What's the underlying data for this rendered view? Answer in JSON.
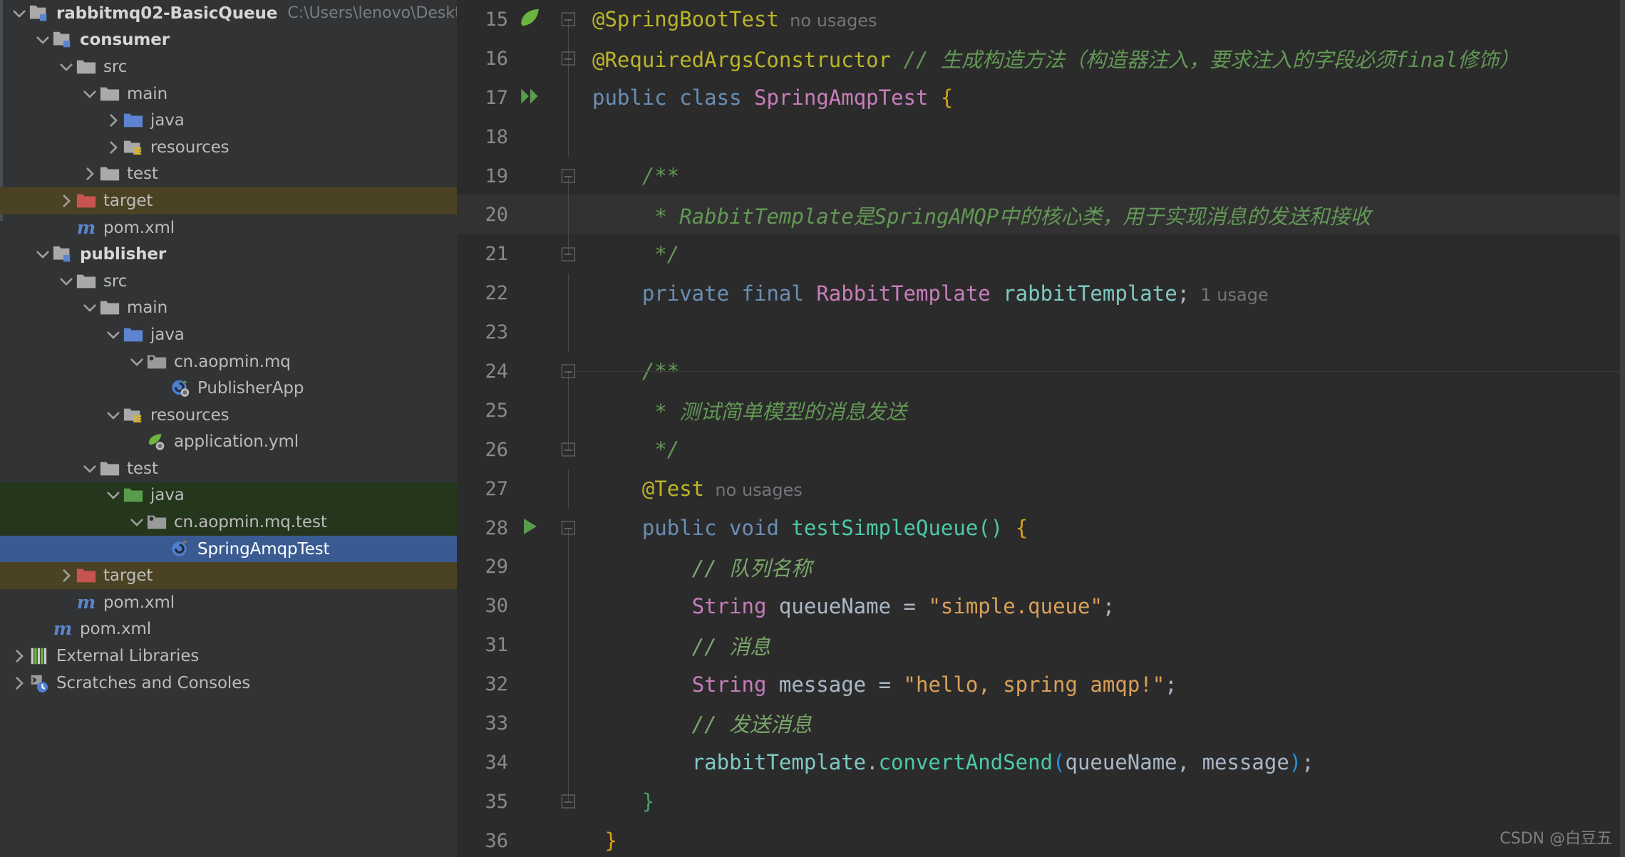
{
  "window": {
    "ide": "IntelliJ IDEA",
    "theme": "Darcula",
    "accent_selected": "#3a5b92",
    "accent_testsrc": "#24361c",
    "accent_excluded": "#4a4222"
  },
  "project_tree": {
    "panel_name": "Project",
    "items": [
      {
        "label": "rabbitmq02-BasicQueue",
        "sub": "C:\\Users\\lenovo\\Deskt",
        "depth": 0,
        "twisty": "expanded",
        "icon": "module-folder-icon",
        "bold": true,
        "state": "normal"
      },
      {
        "label": "consumer",
        "sub": "",
        "depth": 1,
        "twisty": "expanded",
        "icon": "module-folder-icon",
        "bold": true,
        "state": "normal"
      },
      {
        "label": "src",
        "sub": "",
        "depth": 2,
        "twisty": "expanded",
        "icon": "folder-icon",
        "bold": false,
        "state": "normal"
      },
      {
        "label": "main",
        "sub": "",
        "depth": 3,
        "twisty": "expanded",
        "icon": "folder-icon",
        "bold": false,
        "state": "normal"
      },
      {
        "label": "java",
        "sub": "",
        "depth": 4,
        "twisty": "collapsed",
        "icon": "source-folder-icon",
        "bold": false,
        "state": "normal"
      },
      {
        "label": "resources",
        "sub": "",
        "depth": 4,
        "twisty": "collapsed",
        "icon": "resource-folder-icon",
        "bold": false,
        "state": "normal"
      },
      {
        "label": "test",
        "sub": "",
        "depth": 3,
        "twisty": "collapsed",
        "icon": "folder-icon",
        "bold": false,
        "state": "normal"
      },
      {
        "label": "target",
        "sub": "",
        "depth": 2,
        "twisty": "collapsed",
        "icon": "excluded-folder-icon",
        "bold": false,
        "state": "excluded"
      },
      {
        "label": "pom.xml",
        "sub": "",
        "depth": 2,
        "twisty": "none",
        "icon": "maven-file-icon",
        "bold": false,
        "state": "normal"
      },
      {
        "label": "publisher",
        "sub": "",
        "depth": 1,
        "twisty": "expanded",
        "icon": "module-folder-icon",
        "bold": true,
        "state": "normal"
      },
      {
        "label": "src",
        "sub": "",
        "depth": 2,
        "twisty": "expanded",
        "icon": "folder-icon",
        "bold": false,
        "state": "normal"
      },
      {
        "label": "main",
        "sub": "",
        "depth": 3,
        "twisty": "expanded",
        "icon": "folder-icon",
        "bold": false,
        "state": "normal"
      },
      {
        "label": "java",
        "sub": "",
        "depth": 4,
        "twisty": "expanded",
        "icon": "source-folder-icon",
        "bold": false,
        "state": "normal"
      },
      {
        "label": "cn.aopmin.mq",
        "sub": "",
        "depth": 5,
        "twisty": "expanded",
        "icon": "package-icon",
        "bold": false,
        "state": "normal"
      },
      {
        "label": "PublisherApp",
        "sub": "",
        "depth": 6,
        "twisty": "none",
        "icon": "spring-class-icon",
        "bold": false,
        "state": "normal"
      },
      {
        "label": "resources",
        "sub": "",
        "depth": 4,
        "twisty": "expanded",
        "icon": "resource-folder-icon",
        "bold": false,
        "state": "normal"
      },
      {
        "label": "application.yml",
        "sub": "",
        "depth": 5,
        "twisty": "none",
        "icon": "spring-yaml-icon",
        "bold": false,
        "state": "normal"
      },
      {
        "label": "test",
        "sub": "",
        "depth": 3,
        "twisty": "expanded",
        "icon": "folder-icon",
        "bold": false,
        "state": "normal"
      },
      {
        "label": "java",
        "sub": "",
        "depth": 4,
        "twisty": "expanded",
        "icon": "test-source-folder-icon",
        "bold": false,
        "state": "testsrc"
      },
      {
        "label": "cn.aopmin.mq.test",
        "sub": "",
        "depth": 5,
        "twisty": "expanded",
        "icon": "package-icon",
        "bold": false,
        "state": "testsrc"
      },
      {
        "label": "SpringAmqpTest",
        "sub": "",
        "depth": 6,
        "twisty": "none",
        "icon": "test-class-icon",
        "bold": false,
        "state": "selected"
      },
      {
        "label": "target",
        "sub": "",
        "depth": 2,
        "twisty": "collapsed",
        "icon": "excluded-folder-icon",
        "bold": false,
        "state": "excluded"
      },
      {
        "label": "pom.xml",
        "sub": "",
        "depth": 2,
        "twisty": "none",
        "icon": "maven-file-icon",
        "bold": false,
        "state": "normal"
      },
      {
        "label": "pom.xml",
        "sub": "",
        "depth": 1,
        "twisty": "none",
        "icon": "maven-file-icon",
        "bold": false,
        "state": "normal"
      },
      {
        "label": "External Libraries",
        "sub": "",
        "depth": 0,
        "twisty": "collapsed",
        "icon": "libraries-icon",
        "bold": false,
        "state": "normal"
      },
      {
        "label": "Scratches and Consoles",
        "sub": "",
        "depth": 0,
        "twisty": "collapsed",
        "icon": "scratches-icon",
        "bold": false,
        "state": "normal"
      }
    ]
  },
  "editor": {
    "file": "SpringAmqpTest",
    "first_line": 15,
    "lines": [
      {
        "n": "15",
        "gutter_icon": "spring-bean-icon",
        "fold": "start",
        "caret": false,
        "sep_above": false
      },
      {
        "n": "16",
        "gutter_icon": "",
        "fold": "mid",
        "caret": false,
        "sep_above": false
      },
      {
        "n": "17",
        "gutter_icon": "run-all-icon",
        "fold": "rail",
        "caret": false,
        "sep_above": false
      },
      {
        "n": "18",
        "gutter_icon": "",
        "fold": "rail",
        "caret": false,
        "sep_above": false
      },
      {
        "n": "19",
        "gutter_icon": "",
        "fold": "start",
        "caret": false,
        "sep_above": false
      },
      {
        "n": "20",
        "gutter_icon": "",
        "fold": "rail",
        "caret": true,
        "sep_above": false
      },
      {
        "n": "21",
        "gutter_icon": "",
        "fold": "end",
        "caret": false,
        "sep_above": false
      },
      {
        "n": "22",
        "gutter_icon": "",
        "fold": "rail",
        "caret": false,
        "sep_above": false
      },
      {
        "n": "23",
        "gutter_icon": "",
        "fold": "rail",
        "caret": false,
        "sep_above": false
      },
      {
        "n": "24",
        "gutter_icon": "",
        "fold": "start",
        "caret": false,
        "sep_above": true
      },
      {
        "n": "25",
        "gutter_icon": "",
        "fold": "rail",
        "caret": false,
        "sep_above": false
      },
      {
        "n": "26",
        "gutter_icon": "",
        "fold": "end",
        "caret": false,
        "sep_above": false
      },
      {
        "n": "27",
        "gutter_icon": "",
        "fold": "rail",
        "caret": false,
        "sep_above": false
      },
      {
        "n": "28",
        "gutter_icon": "run-test-icon",
        "fold": "start",
        "caret": false,
        "sep_above": false
      },
      {
        "n": "29",
        "gutter_icon": "",
        "fold": "rail",
        "caret": false,
        "sep_above": false
      },
      {
        "n": "30",
        "gutter_icon": "",
        "fold": "rail",
        "caret": false,
        "sep_above": false
      },
      {
        "n": "31",
        "gutter_icon": "",
        "fold": "rail",
        "caret": false,
        "sep_above": false
      },
      {
        "n": "32",
        "gutter_icon": "",
        "fold": "rail",
        "caret": false,
        "sep_above": false
      },
      {
        "n": "33",
        "gutter_icon": "",
        "fold": "rail",
        "caret": false,
        "sep_above": false
      },
      {
        "n": "34",
        "gutter_icon": "",
        "fold": "rail",
        "caret": false,
        "sep_above": false
      },
      {
        "n": "35",
        "gutter_icon": "",
        "fold": "end",
        "caret": false,
        "sep_above": false
      },
      {
        "n": "36",
        "gutter_icon": "",
        "fold": "none",
        "caret": false,
        "sep_above": false
      }
    ],
    "code": {
      "l15": {
        "annotation": "@SpringBootTest",
        "hint": "no usages"
      },
      "l16": {
        "annotation": "@RequiredArgsConstructor",
        "comment": "// 生成构造方法（构造器注入，要求注入的字段必须final修饰）"
      },
      "l17": {
        "kw_public": "public",
        "kw_class": "class",
        "name": "SpringAmqpTest",
        "brace": "{"
      },
      "l19": {
        "text": "/**"
      },
      "l20": {
        "text": "* RabbitTemplate是SpringAMQP中的核心类，用于实现消息的发送和接收"
      },
      "l21": {
        "text": "*/"
      },
      "l22": {
        "kw_private": "private",
        "kw_final": "final",
        "type": "RabbitTemplate",
        "field": "rabbitTemplate",
        "semi": ";",
        "hint": "1 usage"
      },
      "l24": {
        "text": "/**"
      },
      "l25": {
        "text": "* 测试简单模型的消息发送"
      },
      "l26": {
        "text": "*/"
      },
      "l27": {
        "annotation": "@Test",
        "hint": "no usages"
      },
      "l28": {
        "kw_public": "public",
        "kw_void": "void",
        "method": "testSimpleQueue",
        "parens": "()",
        "brace": "{"
      },
      "l29": {
        "text": "// 队列名称"
      },
      "l30": {
        "type": "String",
        "var": "queueName",
        "eq": "=",
        "str": "\"simple.queue\"",
        "semi": ";"
      },
      "l31": {
        "text": "// 消息"
      },
      "l32": {
        "type": "String",
        "var": "message",
        "eq": "=",
        "str": "\"hello, spring amqp!\"",
        "semi": ";"
      },
      "l33": {
        "text": "// 发送消息"
      },
      "l34": {
        "recv": "rabbitTemplate",
        "dot": ".",
        "method": "convertAndSend",
        "open": "(",
        "arg1": "queueName",
        "comma": ", ",
        "arg2": "message",
        "close": ")",
        "semi": ";"
      },
      "l35": {
        "text": "}"
      },
      "l36": {
        "text": "}"
      }
    }
  },
  "watermark": {
    "text": "CSDN @白豆五"
  }
}
